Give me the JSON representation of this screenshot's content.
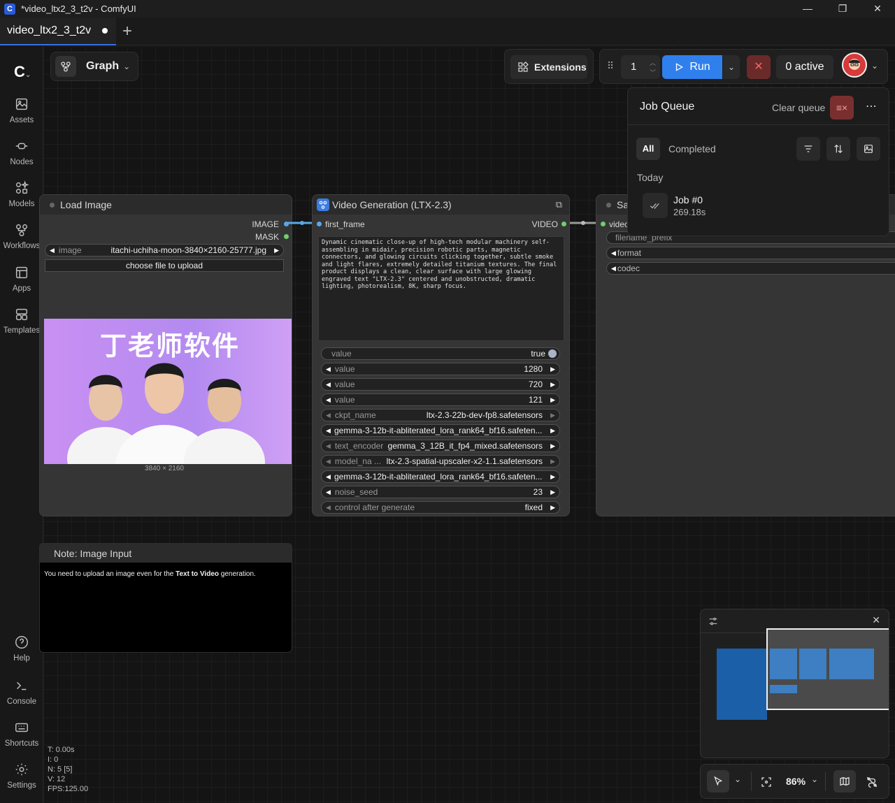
{
  "window": {
    "title": "*video_ltx2_3_t2v - ComfyUI",
    "controls": [
      "—",
      "❐",
      "✕"
    ]
  },
  "tabs": [
    {
      "label": "video_ltx2_3_t2v",
      "unsaved": true
    }
  ],
  "sidebar": {
    "items": [
      {
        "label": "Assets",
        "icon": "assets-icon"
      },
      {
        "label": "Nodes",
        "icon": "nodes-icon"
      },
      {
        "label": "Models",
        "icon": "models-icon"
      },
      {
        "label": "Workflows",
        "icon": "workflows-icon"
      },
      {
        "label": "Apps",
        "icon": "apps-icon"
      },
      {
        "label": "Templates",
        "icon": "templates-icon"
      }
    ],
    "bottom_items": [
      {
        "label": "Help",
        "icon": "help-icon"
      },
      {
        "label": "Console",
        "icon": "console-icon"
      },
      {
        "label": "Shortcuts",
        "icon": "keyboard-icon"
      },
      {
        "label": "Settings",
        "icon": "gear-icon"
      }
    ]
  },
  "toolbar": {
    "graph_label": "Graph",
    "extensions_label": "Extensions",
    "batch_count": "1",
    "run_label": "Run",
    "active_label": "0 active"
  },
  "job_queue": {
    "title": "Job Queue",
    "clear_label": "Clear queue",
    "tab_all": "All",
    "tab_completed": "Completed",
    "group": "Today",
    "jobs": [
      {
        "name": "Job #0",
        "time": "269.18s"
      }
    ]
  },
  "nodes": {
    "load_image": {
      "title": "Load Image",
      "outputs": [
        "IMAGE",
        "MASK"
      ],
      "image_label": "image",
      "image_value": "itachi-uchiha-moon-3840×2160-25777.jpg",
      "upload_label": "choose file to upload",
      "preview_text": "丁老师软件",
      "preview_size": "3840 × 2160"
    },
    "video_gen": {
      "title": "Video Generation (LTX-2.3)",
      "input": "first_frame",
      "output": "VIDEO",
      "prompt": "Dynamic cinematic close-up of high-tech modular machinery self-assembling in midair, precision robotic parts, magnetic connectors, and glowing circuits clicking together, subtle smoke and light flares, extremely detailed titanium textures. The final product displays a clean, clear surface with large glowing engraved text \"LTX-2.3\" centered and unobstructed, dramatic lighting, photorealism, 8K, sharp focus.",
      "widgets": [
        {
          "label": "value",
          "value": "true"
        },
        {
          "label": "value",
          "value": "1280"
        },
        {
          "label": "value",
          "value": "720"
        },
        {
          "label": "value",
          "value": "121"
        },
        {
          "label": "ckpt_name",
          "value": "ltx-2.3-22b-dev-fp8.safetensors"
        },
        {
          "label": "",
          "value": "gemma-3-12b-it-abliterated_lora_rank64_bf16.safeten..."
        },
        {
          "label": "text_encoder",
          "value": "gemma_3_12B_it_fp4_mixed.safetensors"
        },
        {
          "label": "model_na ...",
          "value": "ltx-2.3-spatial-upscaler-x2-1.1.safetensors"
        },
        {
          "label": "",
          "value": "gemma-3-12b-it-abliterated_lora_rank64_bf16.safeten..."
        },
        {
          "label": "noise_seed",
          "value": "23"
        },
        {
          "label": "control after generate",
          "value": "fixed"
        }
      ]
    },
    "save_video": {
      "title": "Sa",
      "input": "video",
      "widgets": [
        "filename_prefix",
        "format",
        "codec"
      ]
    },
    "note": {
      "title": "Note: Image Input",
      "text_prefix": "You need to upload an image even for the ",
      "text_bold": "Text to Video",
      "text_suffix": " generation."
    }
  },
  "stats": {
    "t": "T: 0.00s",
    "i": "I: 0",
    "n": "N: 5 [5]",
    "v": "V: 12",
    "fps": "FPS:125.00"
  },
  "zoom": {
    "level": "86%"
  }
}
